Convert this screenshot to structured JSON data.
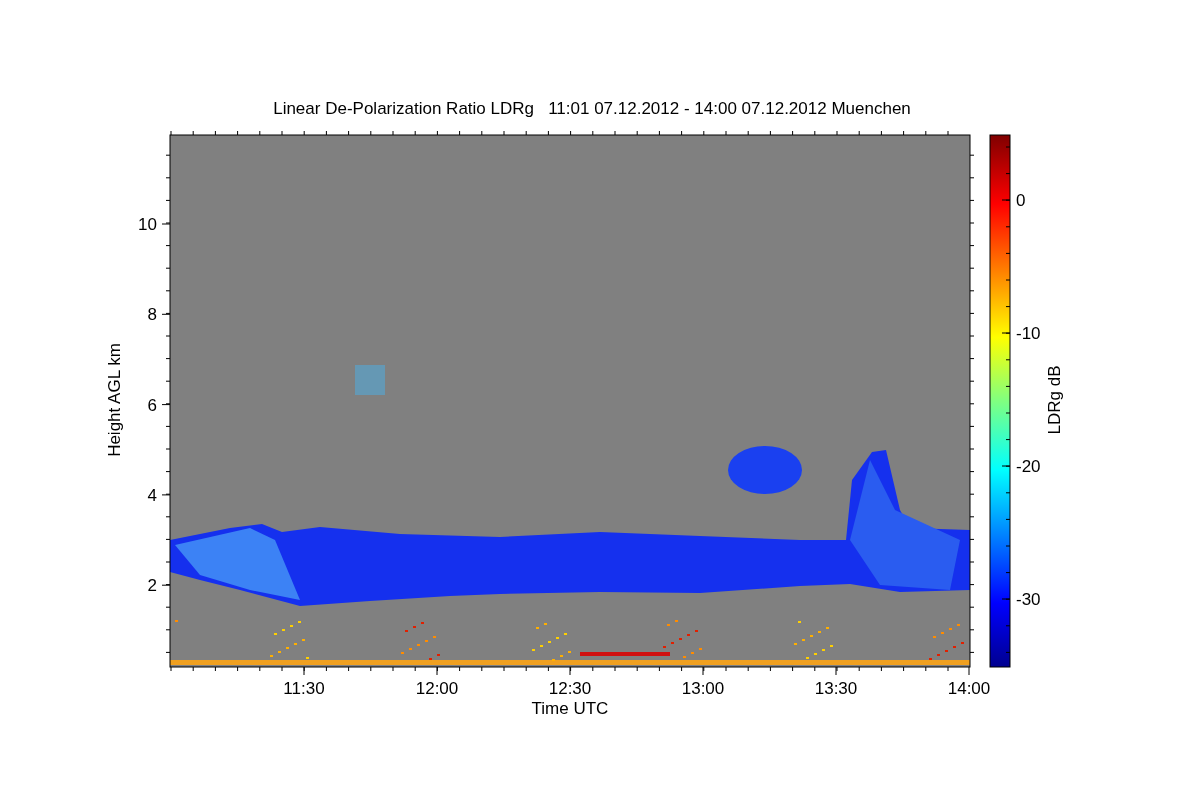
{
  "plot": {
    "title": "Linear De-Polarization Ratio LDRg   11:01 07.12.2012 - 14:00 07.12.2012 Muenchen",
    "xlabel": "Time UTC",
    "ylabel": "Height AGL km",
    "xticks": [
      "11:30",
      "12:00",
      "12:30",
      "13:00",
      "13:30",
      "14:00"
    ],
    "yticks": [
      "10",
      "8",
      "6",
      "4",
      "2"
    ]
  },
  "colorbar": {
    "label": "LDRg dB",
    "ticks": [
      "0",
      "-10",
      "-20",
      "-30"
    ]
  }
}
